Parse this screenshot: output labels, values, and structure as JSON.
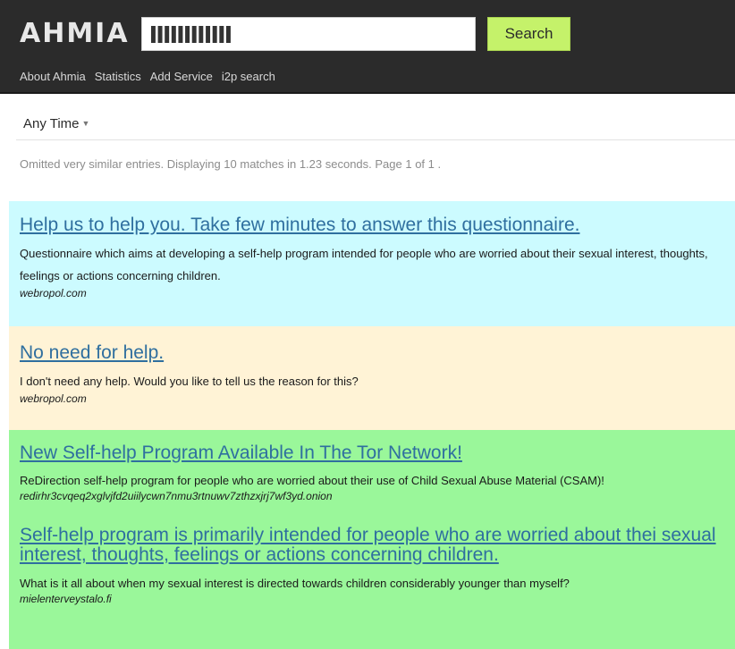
{
  "header": {
    "logo": "AHMIA",
    "search": {
      "value": "▌▌▌▌▌▌▌▌▌▌▌▌",
      "placeholder": ""
    },
    "search_button": "Search",
    "nav": [
      "About Ahmia",
      "Statistics",
      "Add Service",
      "i2p search"
    ]
  },
  "filters": {
    "time": "Any Time"
  },
  "summary": "Omitted very similar entries. Displaying 10 matches in 1.23 seconds. Page 1 of 1 .",
  "results": [
    {
      "title": "Help us to help you. Take few minutes to answer this questionnaire.",
      "description": "Questionnaire which aims at developing a self-help program intended for people who are worried about their sexual interest, thoughts, feelings or actions concerning children.",
      "site": "webropol.com",
      "background": "#ccfbff"
    },
    {
      "title": "No need for help.",
      "description": "I don't need any help. Would you like to tell us the reason for this?",
      "site": "webropol.com",
      "background": "#fff3d6"
    },
    {
      "title": "New Self-help Program Available In The Tor Network!",
      "description": "ReDirection self-help program for people who are worried about their use of Child Sexual Abuse Material (CSAM)!",
      "site": "redirhr3cvqeq2xglvjfd2uiilycwn7nmu3rtnuwv7zthzxjrj7wf3yd.onion",
      "background": "#9af79a"
    },
    {
      "title": "Self-help program is primarily intended for people who are worried about thei sexual interest, thoughts, feelings or actions concerning children.",
      "description": "What is it all about when my sexual interest is directed towards children considerably younger than myself?",
      "site": "mielenterveystalo.fi",
      "background": "#9af79a"
    }
  ],
  "colors": {
    "header_bg": "#2b2b2b",
    "search_button_bg": "#c5f26a",
    "link": "#2f6f9f"
  }
}
